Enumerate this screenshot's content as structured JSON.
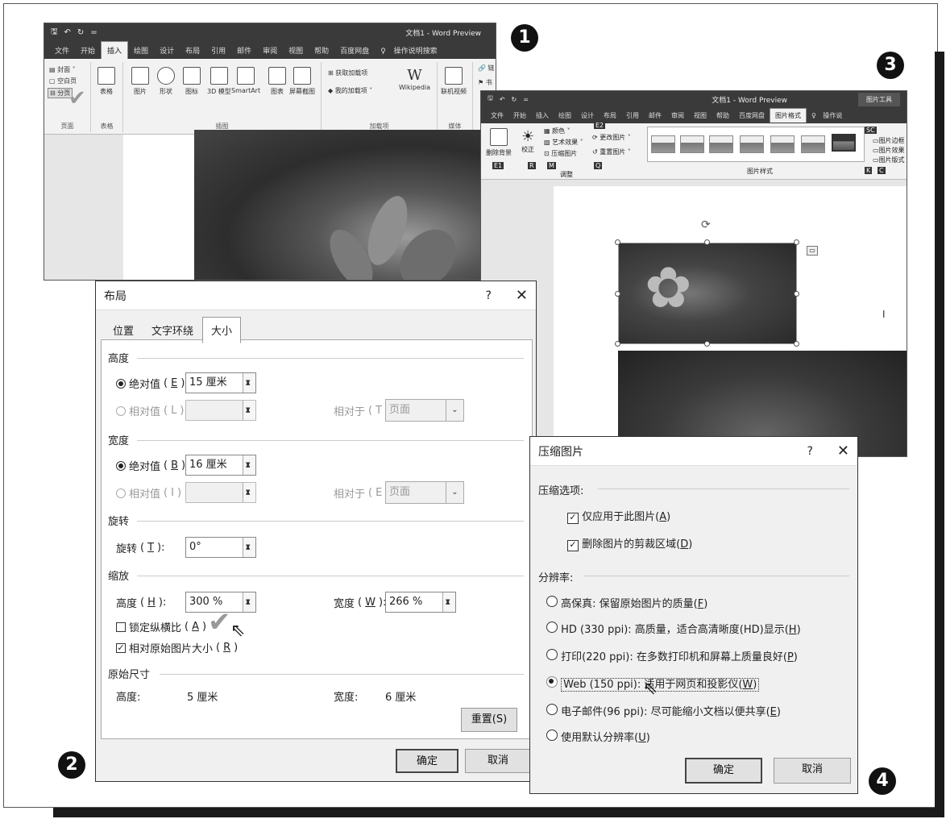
{
  "badges": {
    "b1": "1",
    "b2": "2",
    "b3": "3",
    "b4": "4"
  },
  "win1": {
    "title": "文档1 - Word Preview",
    "qat": {
      "save": "🖫",
      "undo": "↶",
      "redo": "↻",
      "more": "="
    },
    "tabs": [
      "文件",
      "开始",
      "插入",
      "绘图",
      "设计",
      "布局",
      "引用",
      "邮件",
      "审阅",
      "视图",
      "帮助",
      "百度网盘",
      "操作说明搜索"
    ],
    "active_tab": "插入",
    "pages_group": {
      "items": [
        "封面",
        "空白页",
        "分页"
      ],
      "label": "页面"
    },
    "table_group": {
      "item": "表格",
      "label": "表格"
    },
    "illus_group": {
      "items": [
        "图片",
        "形状",
        "图标",
        "3D 模型",
        "SmartArt",
        "图表",
        "屏幕截图"
      ],
      "label": "插图"
    },
    "addins_group": {
      "items": [
        "获取加载项",
        "我的加载项",
        "Wikipedia"
      ],
      "label": "加载项"
    },
    "media_group": {
      "item": "联机视频",
      "label": "媒体"
    },
    "links_group": {
      "items": [
        "链",
        "书"
      ]
    }
  },
  "win3": {
    "title": "文档1 - Word Preview",
    "context_tab": "图片工具",
    "tabs": [
      "文件",
      "开始",
      "插入",
      "绘图",
      "设计",
      "布局",
      "引用",
      "邮件",
      "审阅",
      "视图",
      "帮助",
      "百度网盘",
      "图片格式",
      "操作说"
    ],
    "active_tab": "图片格式",
    "adjust": {
      "remove_bg": "删除背景",
      "correct": "校正",
      "color": "颜色",
      "art": "艺术效果",
      "compress": "压缩图片",
      "change": "更改图片",
      "reset": "重置图片",
      "label": "调整"
    },
    "keytips": [
      "E1",
      "R",
      "M",
      "Q",
      "E2",
      "SC",
      "K",
      "C"
    ],
    "styles_label": "图片样式",
    "right_items": [
      "图片边框",
      "图片效果",
      "图片版式"
    ]
  },
  "layout_dialog": {
    "title": "布局",
    "help": "?",
    "close": "✕",
    "tabs": [
      "位置",
      "文字环绕",
      "大小"
    ],
    "active_tab": "大小",
    "height_section": "高度",
    "height_abs_label": "绝对值",
    "height_abs_key": "E",
    "height_abs_value": "15 厘米",
    "height_rel_label": "相对值",
    "height_rel_key": "L",
    "height_rel_to_label": "相对于",
    "height_rel_to_key": "T",
    "height_rel_to_value": "页面",
    "width_section": "宽度",
    "width_abs_label": "绝对值",
    "width_abs_key": "B",
    "width_abs_value": "16 厘米",
    "width_rel_label": "相对值",
    "width_rel_key": "I",
    "width_rel_to_label": "相对于",
    "width_rel_to_key": "E",
    "width_rel_to_value": "页面",
    "rotate_section": "旋转",
    "rotate_label": "旋转",
    "rotate_key": "T",
    "rotate_value": "0°",
    "scale_section": "缩放",
    "scale_h_label": "高度",
    "scale_h_key": "H",
    "scale_h_value": "300 %",
    "scale_w_label": "宽度",
    "scale_w_key": "W",
    "scale_w_value": "266 %",
    "lock_label": "锁定纵横比",
    "lock_key": "A",
    "lock_checked": false,
    "relative_label": "相对原始图片大小",
    "relative_key": "R",
    "relative_checked": true,
    "orig_section": "原始尺寸",
    "orig_h_label": "高度:",
    "orig_h_value": "5 厘米",
    "orig_w_label": "宽度:",
    "orig_w_value": "6 厘米",
    "reset": "重置(S)",
    "ok": "确定",
    "cancel": "取消"
  },
  "compress_dialog": {
    "title": "压缩图片",
    "help": "?",
    "close": "✕",
    "options_label": "压缩选项:",
    "opt1": "仅应用于此图片",
    "opt1_key": "A",
    "opt2": "删除图片的剪裁区域",
    "opt2_key": "D",
    "resolution_label": "分辨率:",
    "res": [
      {
        "text": "高保真: 保留原始图片的质量",
        "key": "F",
        "selected": false
      },
      {
        "text": "HD (330 ppi): 高质量，适合高清晰度(HD)显示",
        "key": "H",
        "selected": false
      },
      {
        "text": "打印(220 ppi): 在多数打印机和屏幕上质量良好",
        "key": "P",
        "selected": false
      },
      {
        "text": "Web (150 ppi): 适用于网页和投影仪",
        "key": "W",
        "selected": true
      },
      {
        "text": "电子邮件(96 ppi): 尽可能缩小文档以便共享",
        "key": "E",
        "selected": false
      },
      {
        "text": "使用默认分辨率",
        "key": "U",
        "selected": false
      }
    ],
    "ok": "确定",
    "cancel": "取消"
  }
}
